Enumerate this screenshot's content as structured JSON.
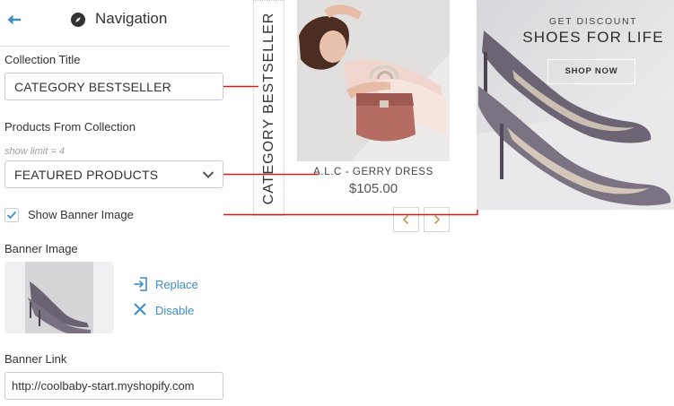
{
  "panel": {
    "title": "Navigation",
    "back_icon": "arrow-left-icon",
    "nav_icon": "compass-icon"
  },
  "form": {
    "collection_title_label": "Collection Title",
    "collection_title_value": "CATEGORY BESTSELLER",
    "products_label": "Products From Collection",
    "products_hint": "show limit = 4",
    "products_selected": "FEATURED PRODUCTS",
    "show_banner_label": "Show Banner Image",
    "show_banner_checked": true,
    "banner_image_label": "Banner Image",
    "replace_label": "Replace",
    "disable_label": "Disable",
    "banner_link_label": "Banner Link",
    "banner_link_value": "http://coolbaby-start.myshopify.com"
  },
  "preview": {
    "section_title": "CATEGORY BESTSELLER",
    "product": {
      "name": "A.L.C - GERRY DRESS",
      "price": "$105.00"
    },
    "banner": {
      "small_text": "GET DISCOUNT",
      "big_text": "SHOES FOR LIFE",
      "button": "SHOP NOW"
    }
  },
  "colors": {
    "accent_blue": "#3d8ec8",
    "connector_red": "#cc1f1f",
    "border": "#c4cdd5"
  }
}
